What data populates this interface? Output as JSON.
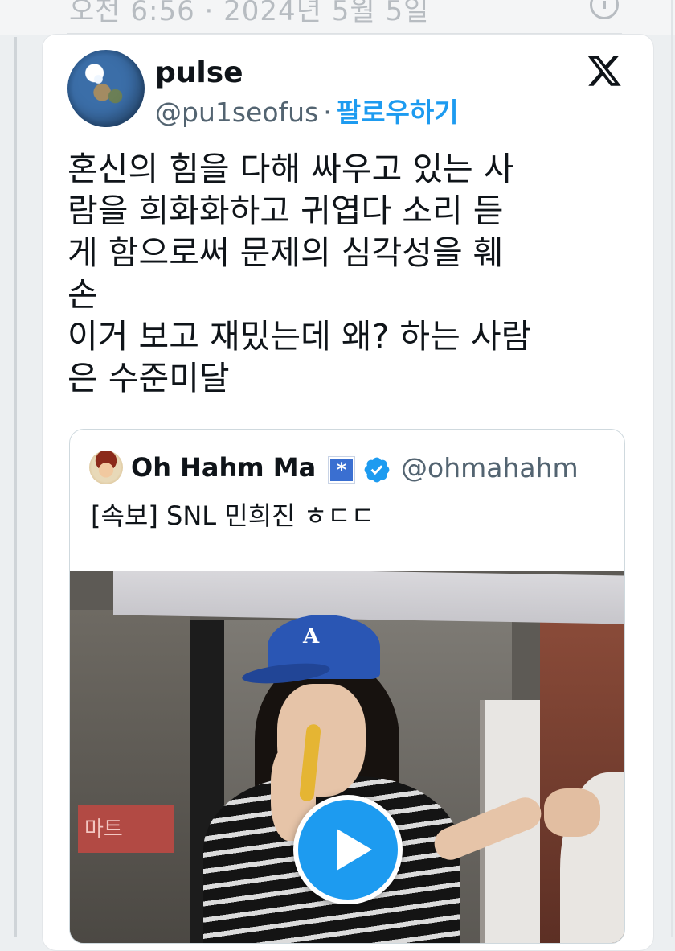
{
  "status_bar": {
    "timestamp_text": "오전 6:56 · 2024년 5월 5일"
  },
  "tweet": {
    "author_name": "pulse",
    "author_handle": "@pu1seofus",
    "separator": "·",
    "follow_label": "팔로우하기",
    "body": "혼신의 힘을 다해 싸우고 있는 사\n람을 희화화하고 귀엽다 소리 듣\n게 함으로써 문제의 심각성을 훼\n손\n이거 보고 재밌는데 왜? 하는 사람\n은 수준미달"
  },
  "quoted_tweet": {
    "author_name": "Oh Hahm Ma",
    "badge_symbol": "*",
    "author_handle": "@ohmahahm",
    "body": "[속보] SNL 민희진 ㅎㄷㄷ",
    "video_sign_text": "마트"
  },
  "icons": {
    "brand": "x-logo-icon",
    "verified": "verified-badge-icon",
    "affiliate": "affiliate-badge-icon",
    "media": "play-button-icon",
    "top_action": "info-icon"
  },
  "colors": {
    "follow": "#1d9bf0",
    "play_button": "#1d9bf0",
    "secondary_text": "#536471",
    "badge": "#3a6fd1"
  }
}
